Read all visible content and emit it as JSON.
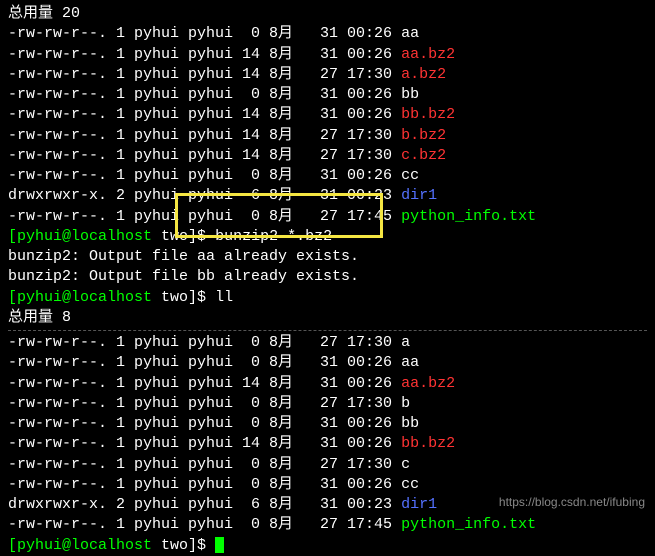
{
  "header1": "总用量 20",
  "listing1": [
    {
      "perm": "-rw-rw-r--.",
      "links": "1",
      "owner": "pyhui",
      "group": "pyhui",
      "size": " 0",
      "mon": "8月",
      "day": "  31",
      "time": "00:26",
      "name": "aa",
      "cls": ""
    },
    {
      "perm": "-rw-rw-r--.",
      "links": "1",
      "owner": "pyhui",
      "group": "pyhui",
      "size": "14",
      "mon": "8月",
      "day": "  31",
      "time": "00:26",
      "name": "aa.bz2",
      "cls": "red"
    },
    {
      "perm": "-rw-rw-r--.",
      "links": "1",
      "owner": "pyhui",
      "group": "pyhui",
      "size": "14",
      "mon": "8月",
      "day": "  27",
      "time": "17:30",
      "name": "a.bz2",
      "cls": "red"
    },
    {
      "perm": "-rw-rw-r--.",
      "links": "1",
      "owner": "pyhui",
      "group": "pyhui",
      "size": " 0",
      "mon": "8月",
      "day": "  31",
      "time": "00:26",
      "name": "bb",
      "cls": ""
    },
    {
      "perm": "-rw-rw-r--.",
      "links": "1",
      "owner": "pyhui",
      "group": "pyhui",
      "size": "14",
      "mon": "8月",
      "day": "  31",
      "time": "00:26",
      "name": "bb.bz2",
      "cls": "red"
    },
    {
      "perm": "-rw-rw-r--.",
      "links": "1",
      "owner": "pyhui",
      "group": "pyhui",
      "size": "14",
      "mon": "8月",
      "day": "  27",
      "time": "17:30",
      "name": "b.bz2",
      "cls": "red"
    },
    {
      "perm": "-rw-rw-r--.",
      "links": "1",
      "owner": "pyhui",
      "group": "pyhui",
      "size": "14",
      "mon": "8月",
      "day": "  27",
      "time": "17:30",
      "name": "c.bz2",
      "cls": "red"
    },
    {
      "perm": "-rw-rw-r--.",
      "links": "1",
      "owner": "pyhui",
      "group": "pyhui",
      "size": " 0",
      "mon": "8月",
      "day": "  31",
      "time": "00:26",
      "name": "cc",
      "cls": ""
    },
    {
      "perm": "drwxrwxr-x.",
      "links": "2",
      "owner": "pyhui",
      "group": "pyhui",
      "size": " 6",
      "mon": "8月",
      "day": "  31",
      "time": "00:23",
      "name": "dir1",
      "cls": "blue"
    },
    {
      "perm": "-rw-rw-r--.",
      "links": "1",
      "owner": "pyhui",
      "group": "pyhui",
      "size": " 0",
      "mon": "8月",
      "day": "  27",
      "time": "17:45",
      "name": "python_info.txt",
      "cls": "green"
    }
  ],
  "prompt": {
    "user": "[pyhui@localhost",
    "path": " two",
    "end": "]$ "
  },
  "cmd1": "bunzip2 *.bz2",
  "output1": "bunzip2: Output file aa already exists.",
  "output2": "bunzip2: Output file bb already exists.",
  "cmd2": "ll",
  "header2": "总用量 8",
  "listing2": [
    {
      "perm": "-rw-rw-r--.",
      "links": "1",
      "owner": "pyhui",
      "group": "pyhui",
      "size": " 0",
      "mon": "8月",
      "day": "  27",
      "time": "17:30",
      "name": "a",
      "cls": ""
    },
    {
      "perm": "-rw-rw-r--.",
      "links": "1",
      "owner": "pyhui",
      "group": "pyhui",
      "size": " 0",
      "mon": "8月",
      "day": "  31",
      "time": "00:26",
      "name": "aa",
      "cls": ""
    },
    {
      "perm": "-rw-rw-r--.",
      "links": "1",
      "owner": "pyhui",
      "group": "pyhui",
      "size": "14",
      "mon": "8月",
      "day": "  31",
      "time": "00:26",
      "name": "aa.bz2",
      "cls": "red"
    },
    {
      "perm": "-rw-rw-r--.",
      "links": "1",
      "owner": "pyhui",
      "group": "pyhui",
      "size": " 0",
      "mon": "8月",
      "day": "  27",
      "time": "17:30",
      "name": "b",
      "cls": ""
    },
    {
      "perm": "-rw-rw-r--.",
      "links": "1",
      "owner": "pyhui",
      "group": "pyhui",
      "size": " 0",
      "mon": "8月",
      "day": "  31",
      "time": "00:26",
      "name": "bb",
      "cls": ""
    },
    {
      "perm": "-rw-rw-r--.",
      "links": "1",
      "owner": "pyhui",
      "group": "pyhui",
      "size": "14",
      "mon": "8月",
      "day": "  31",
      "time": "00:26",
      "name": "bb.bz2",
      "cls": "red"
    },
    {
      "perm": "-rw-rw-r--.",
      "links": "1",
      "owner": "pyhui",
      "group": "pyhui",
      "size": " 0",
      "mon": "8月",
      "day": "  27",
      "time": "17:30",
      "name": "c",
      "cls": ""
    },
    {
      "perm": "-rw-rw-r--.",
      "links": "1",
      "owner": "pyhui",
      "group": "pyhui",
      "size": " 0",
      "mon": "8月",
      "day": "  31",
      "time": "00:26",
      "name": "cc",
      "cls": ""
    },
    {
      "perm": "drwxrwxr-x.",
      "links": "2",
      "owner": "pyhui",
      "group": "pyhui",
      "size": " 6",
      "mon": "8月",
      "day": "  31",
      "time": "00:23",
      "name": "dir1",
      "cls": "blue"
    },
    {
      "perm": "-rw-rw-r--.",
      "links": "1",
      "owner": "pyhui",
      "group": "pyhui",
      "size": " 0",
      "mon": "8月",
      "day": "  27",
      "time": "17:45",
      "name": "python_info.txt",
      "cls": "green"
    }
  ],
  "watermark": "https://blog.csdn.net/ifubing"
}
